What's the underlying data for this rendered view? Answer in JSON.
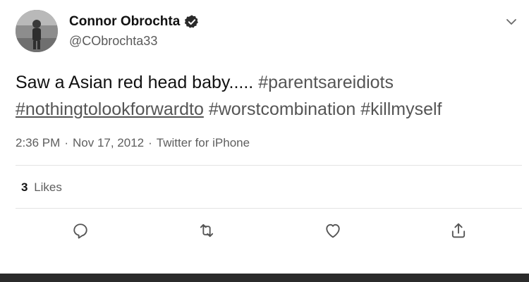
{
  "user": {
    "display_name": "Connor Obrochta",
    "handle": "@CObrochta33",
    "verified_icon": "verified-badge-icon",
    "avatar": "avatar"
  },
  "tweet": {
    "text_plain": "Saw a Asian red head baby.....",
    "hashtags": [
      "#parentsareidiots",
      "#nothingtolookforwardto",
      "#worstcombination",
      "#killmyself"
    ]
  },
  "meta": {
    "time": "2:36 PM",
    "sep1": "·",
    "date": "Nov 17, 2012",
    "sep2": "·",
    "source": "Twitter for iPhone"
  },
  "likes": {
    "count": "3",
    "label": "Likes"
  },
  "actions": {
    "reply": "reply-icon",
    "retweet": "retweet-icon",
    "like": "heart-icon",
    "share": "share-icon",
    "more": "chevron-down-icon"
  },
  "colors": {
    "text": "#111111",
    "secondary": "#5e5e5e",
    "hashtag": "#555555",
    "divider": "#e3e3e3",
    "bottom_bar": "#2b2b2b"
  }
}
